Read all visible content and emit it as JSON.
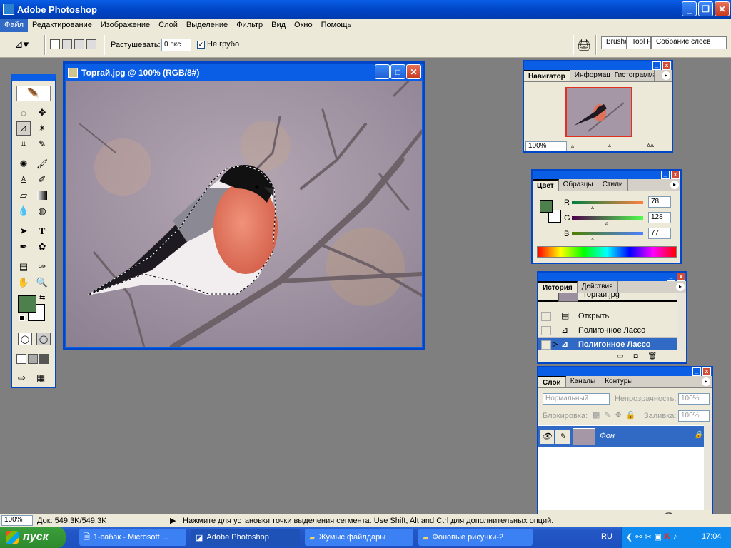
{
  "app": {
    "title": "Adobe Photoshop"
  },
  "menu": [
    "Файл",
    "Редактирование",
    "Изображение",
    "Слой",
    "Выделение",
    "Фильтр",
    "Вид",
    "Окно",
    "Помощь"
  ],
  "options": {
    "feather_label": "Растушевать:",
    "feather_value": "0 пкс",
    "antialias_label": "Не грубо",
    "wells": [
      "Brushes",
      "Tool Presets",
      "Собрание слоев"
    ]
  },
  "document": {
    "title": "Торгай.jpg @ 100% (RGB/8#)"
  },
  "navigator": {
    "tabs": [
      "Навигатор",
      "Информация",
      "Гистограмма"
    ],
    "zoom": "100%"
  },
  "color": {
    "tabs": [
      "Цвет",
      "Образцы",
      "Стили"
    ],
    "r_label": "R",
    "g_label": "G",
    "b_label": "B",
    "r": "78",
    "g": "128",
    "b": "77",
    "fg": "#4e804d"
  },
  "history": {
    "tabs": [
      "История",
      "Действия"
    ],
    "snapshot": "Торгай.jpg",
    "items": [
      "Открыть",
      "Полигонное Лассо",
      "Полигонное Лассо"
    ]
  },
  "layers": {
    "tabs": [
      "Слои",
      "Каналы",
      "Контуры"
    ],
    "blend": "Нормальный",
    "opacity_label": "Непрозрачность:",
    "opacity": "100%",
    "lock_label": "Блокировка:",
    "fill_label": "Заливка:",
    "fill": "100%",
    "layer_name": "Фон"
  },
  "status": {
    "zoom": "100%",
    "doc": "Док: 549,3K/549,3K",
    "hint": "Нажмите для установки точки выделения сегмента. Use Shift, Alt and Ctrl для дополнительных опций."
  },
  "taskbar": {
    "start": "пуск",
    "tasks": [
      "1-сабак - Microsoft ...",
      "Adobe Photoshop",
      "Жумыс файлдары",
      "Фоновые рисунки-2"
    ],
    "lang": "RU",
    "time": "17:04"
  }
}
